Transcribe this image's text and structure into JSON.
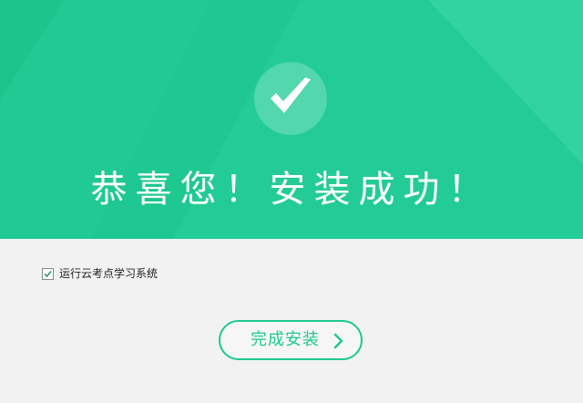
{
  "banner": {
    "title": "恭喜您！安装成功！",
    "success_icon": "check-icon",
    "color": "#1ec890"
  },
  "option": {
    "label": "运行云考点学习系统",
    "checked": true
  },
  "finish_button": {
    "label": "完成安装",
    "icon": "chevron-right-icon"
  },
  "colors": {
    "accent": "#1ec890",
    "background": "#f2f2f2"
  }
}
